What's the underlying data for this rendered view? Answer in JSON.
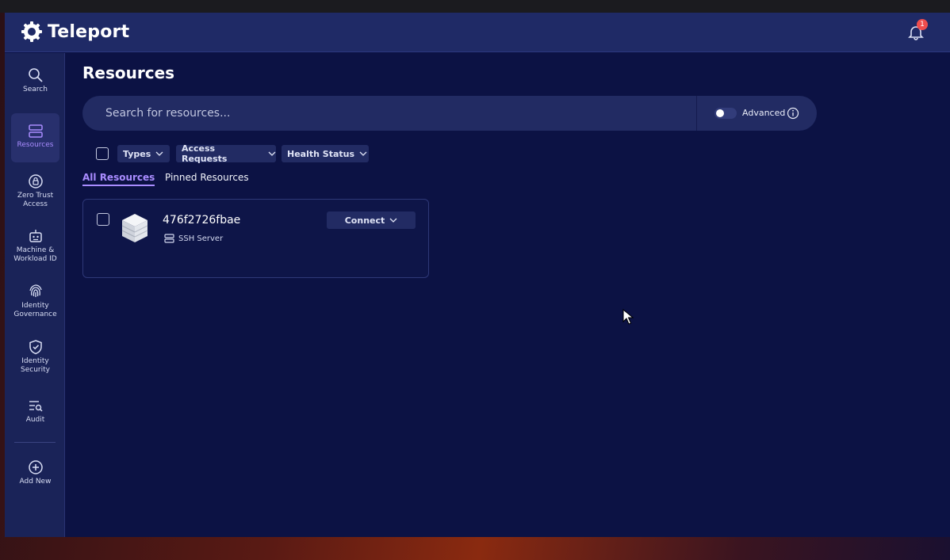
{
  "app": {
    "name": "Teleport",
    "notification_count": "1"
  },
  "sidebar": {
    "items": [
      {
        "label": "Search",
        "icon": "search-icon"
      },
      {
        "label": "Resources",
        "icon": "server-stack-icon",
        "active": true
      },
      {
        "label": "Zero Trust Access",
        "icon": "lock-circle-icon"
      },
      {
        "label": "Machine & Workload ID",
        "icon": "robot-icon"
      },
      {
        "label": "Identity Governance",
        "icon": "fingerprint-icon"
      },
      {
        "label": "Identity Security",
        "icon": "shield-check-icon"
      },
      {
        "label": "Audit",
        "icon": "audit-list-icon"
      },
      {
        "label": "Add New",
        "icon": "plus-circle-icon"
      }
    ]
  },
  "main": {
    "title": "Resources",
    "search": {
      "placeholder": "Search for resources...",
      "advanced_label": "Advanced"
    },
    "filters": {
      "types": "Types",
      "access_requests": "Access Requests",
      "health_status": "Health Status"
    },
    "tabs": {
      "all": "All Resources",
      "pinned": "Pinned Resources"
    },
    "resources": [
      {
        "name": "476f2726fbae",
        "type": "SSH Server",
        "action": "Connect"
      }
    ]
  },
  "colors": {
    "accent": "#a98cff",
    "background": "#0c1244",
    "topbar": "#1f2a66",
    "badge": "#ef4d4d"
  }
}
